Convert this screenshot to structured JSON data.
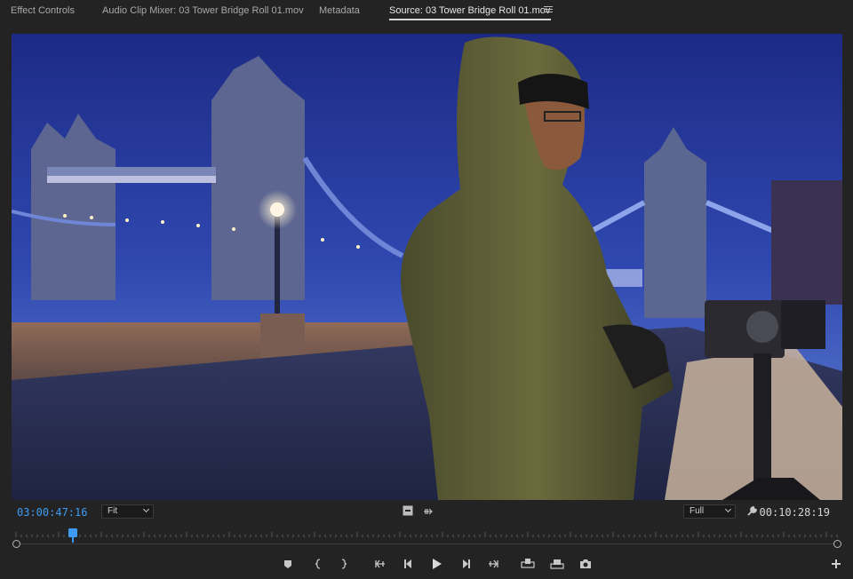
{
  "tabs": [
    {
      "label": "Effect Controls",
      "active": false
    },
    {
      "label": "Audio Clip Mixer: 03 Tower Bridge Roll 01.mov",
      "active": false
    },
    {
      "label": "Metadata",
      "active": false
    },
    {
      "label": "Source: 03 Tower Bridge Roll 01.mov",
      "active": true
    }
  ],
  "viewer": {
    "content": "video frame: hooded man holding camera on riverside walkway at dusk with Tower Bridge in background"
  },
  "controls": {
    "current_timecode": "03:00:47:16",
    "zoom_select": "Fit",
    "resolution_select": "Full",
    "duration_timecode": "00:10:28:19"
  },
  "scrubber": {
    "playhead_position": 0.069
  },
  "transport_buttons": [
    "add-marker",
    "mark-in",
    "mark-out",
    "go-to-in",
    "step-back",
    "play",
    "step-forward",
    "go-to-out",
    "insert",
    "overwrite",
    "export-frame"
  ],
  "colors": {
    "accent": "#3d9bf5",
    "panel_bg": "#232323"
  }
}
